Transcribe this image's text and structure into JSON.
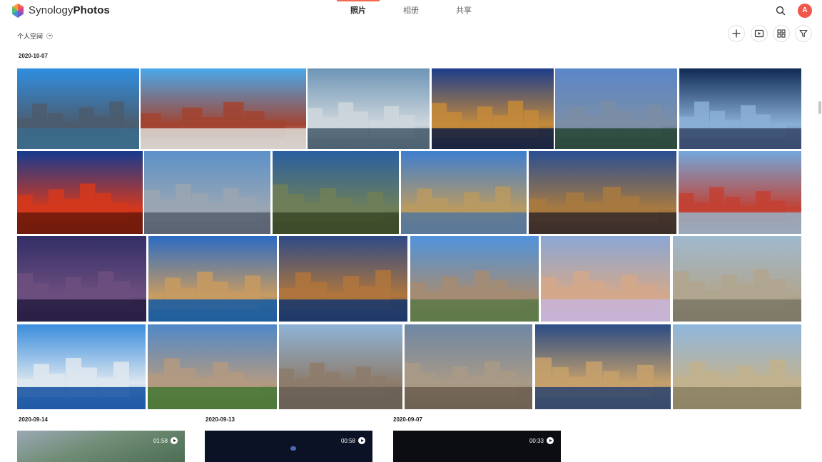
{
  "header": {
    "brand_prefix": "Synology",
    "brand_suffix": "Photos",
    "tabs": [
      {
        "label": "照片",
        "active": true
      },
      {
        "label": "相册",
        "active": false
      },
      {
        "label": "共享",
        "active": false
      }
    ],
    "avatar_initial": "A",
    "accent_color": "#f06a4f"
  },
  "toolbar": {
    "space_label": "个人空间",
    "icons": [
      "add-icon",
      "slideshow-icon",
      "grid-view-icon",
      "filter-icon"
    ]
  },
  "sections": [
    {
      "date": "2020-10-07"
    },
    {
      "date": "2020-09-14",
      "duration": "01:58"
    },
    {
      "date": "2020-09-13",
      "duration": "00:58"
    },
    {
      "date": "2020-09-07",
      "duration": "00:33"
    }
  ],
  "photos": [
    {
      "name": "shanghai-skyline",
      "sky": "#2f8ee0",
      "ground": "#3c6a8a",
      "sil": "#4c5c6e"
    },
    {
      "name": "moscow-red-square",
      "sky": "#4aa9ea",
      "ground": "#d8d0cc",
      "sil": "#a34431"
    },
    {
      "name": "dusseldorf-tower",
      "sky": "#6e95b6",
      "ground": "#4d6272",
      "sil": "#cfd7dd"
    },
    {
      "name": "cathedral-night",
      "sky": "#1c3d8a",
      "ground": "#1b2541",
      "sil": "#c58a3a"
    },
    {
      "name": "taipei-dusk",
      "sky": "#5a86c8",
      "ground": "#2c4a3d",
      "sil": "#7c8ea6"
    },
    {
      "name": "stadium-aerial-night",
      "sky": "#0f2a55",
      "ground": "#3b4d70",
      "sil": "#8ab0d8"
    },
    {
      "name": "birds-nest-stadium",
      "sky": "#163b8f",
      "ground": "#721b0c",
      "sil": "#d5381c"
    },
    {
      "name": "empire-state",
      "sky": "#5c91c9",
      "ground": "#5a6472",
      "sil": "#9aa6b3"
    },
    {
      "name": "sunset-hill-tower",
      "sky": "#2a5fa0",
      "ground": "#3e4b2a",
      "sil": "#6f7f58"
    },
    {
      "name": "big-ben",
      "sky": "#3f7fcf",
      "ground": "#5a7899",
      "sil": "#b99a62"
    },
    {
      "name": "city-towers-dusk",
      "sky": "#2a4f92",
      "ground": "#3d2f2a",
      "sil": "#a87a40"
    },
    {
      "name": "tokyo-tower",
      "sky": "#73a8db",
      "ground": "#9aa9bb",
      "sil": "#c34133"
    },
    {
      "name": "taipei-101-night",
      "sky": "#332e68",
      "ground": "#2a1f44",
      "sil": "#6d4f7f"
    },
    {
      "name": "zurich-river",
      "sky": "#2b6bc4",
      "ground": "#1f5e9f",
      "sil": "#c89b61"
    },
    {
      "name": "prague-bridge",
      "sky": "#2e4a86",
      "ground": "#1e3a6a",
      "sil": "#b0763c"
    },
    {
      "name": "eiffel-tower",
      "sky": "#4f93dd",
      "ground": "#5f7a4a",
      "sil": "#a58c74"
    },
    {
      "name": "milan-duomo",
      "sky": "#8ba7d6",
      "ground": "#c7b3d5",
      "sil": "#d4a88a"
    },
    {
      "name": "warsaw-palace",
      "sky": "#9fb9cf",
      "ground": "#7f7a68",
      "sil": "#b1a68f"
    },
    {
      "name": "sydney-opera",
      "sky": "#3a8ddd",
      "ground": "#1f5aa6",
      "sil": "#dfe8f0"
    },
    {
      "name": "cathedral-trees",
      "sky": "#4f88c8",
      "ground": "#4d7a3a",
      "sil": "#b39a82"
    },
    {
      "name": "street-canal",
      "sky": "#8fb4d8",
      "ground": "#6a6155",
      "sil": "#8d7c6b"
    },
    {
      "name": "statue-columns",
      "sky": "#6e87a4",
      "ground": "#6f6253",
      "sil": "#a99a86"
    },
    {
      "name": "tower-bridge",
      "sky": "#2b4c86",
      "ground": "#364b6e",
      "sil": "#c7a16b"
    },
    {
      "name": "madrid-aerial",
      "sky": "#8fb7de",
      "ground": "#8e8466",
      "sil": "#c3b28e"
    }
  ],
  "videos": [
    {
      "name": "aerial-city-video",
      "bg": "#6f8c74"
    },
    {
      "name": "night-city-video",
      "bg": "#0b1226"
    },
    {
      "name": "dark-scene-video",
      "bg": "#0b0d13"
    }
  ]
}
